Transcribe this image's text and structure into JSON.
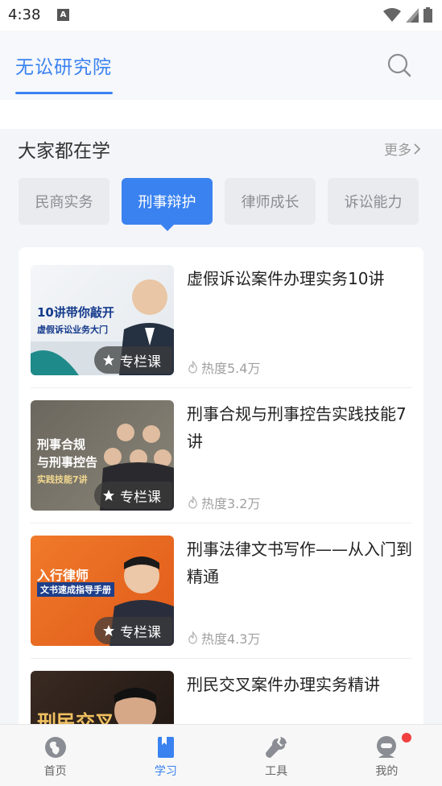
{
  "status_bar": {
    "time": "4:38",
    "notification_icon": "A"
  },
  "header": {
    "brand": "无讼研究院",
    "search_icon": "search-icon"
  },
  "section": {
    "title": "大家都在学",
    "more": "更多"
  },
  "tabs": [
    {
      "label": "民商实务",
      "active": false
    },
    {
      "label": "刑事辩护",
      "active": true
    },
    {
      "label": "律师成长",
      "active": false
    },
    {
      "label": "诉讼能力",
      "active": false
    }
  ],
  "courses": [
    {
      "title": "虚假诉讼案件办理实务10讲",
      "badge": "专栏课",
      "heat": "热度5.4万",
      "thumb_line1": "10讲带你敲开",
      "thumb_line2": "虚假诉讼业务大门"
    },
    {
      "title": "刑事合规与刑事控告实践技能7讲",
      "badge": "专栏课",
      "heat": "热度3.2万",
      "thumb_line1": "刑事合规",
      "thumb_line2": "与刑事控告",
      "thumb_line3": "实践技能7讲"
    },
    {
      "title": "刑事法律文书写作——从入门到精通",
      "badge": "专栏课",
      "heat": "热度4.3万",
      "thumb_line1": "入行律师",
      "thumb_line2": "文书速成指导手册"
    },
    {
      "title": "刑民交叉案件办理实务精讲",
      "badge": "",
      "heat": "",
      "thumb_line1": "刑民交叉"
    }
  ],
  "bottom_nav": [
    {
      "label": "首页",
      "active": false
    },
    {
      "label": "学习",
      "active": true
    },
    {
      "label": "工具",
      "active": false
    },
    {
      "label": "我的",
      "active": false
    }
  ],
  "colors": {
    "accent": "#3a82f0",
    "tab_inactive": "#e9ebef",
    "badge_dot": "#f04040"
  }
}
